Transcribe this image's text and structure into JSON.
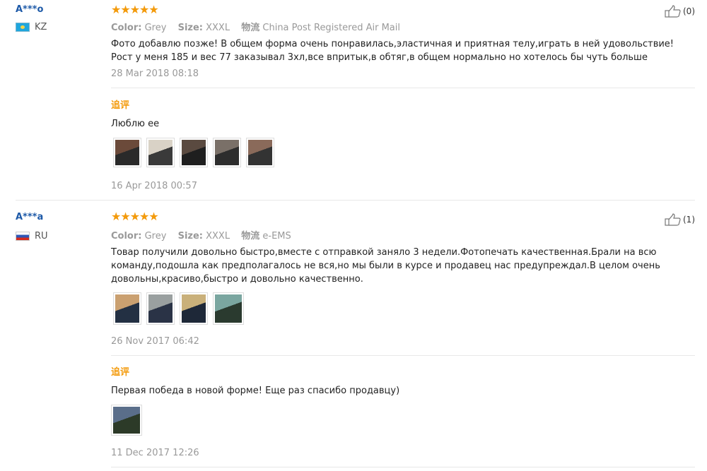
{
  "reviews": [
    {
      "user": "A***o",
      "country": "KZ",
      "flag_icon": "flag-kz-icon",
      "stars": "★★★★★",
      "rating": 5,
      "color_label": "Color:",
      "color_value": "Grey",
      "size_label": "Size:",
      "size_value": "XXXL",
      "ship_label": "物流",
      "ship_value": "China Post Registered Air Mail",
      "text": "Фото добавлю позже! В общем форма очень понравилась,эластичная и приятная телу,играть в ней удовольствие! Рост у меня 185 и вес 77 заказывал 3хл,все впритык,в обтяг,в общем нормально но хотелось бы чуть больше",
      "date": "28 Mar 2018 08:18",
      "likes": "(0)",
      "followup": {
        "tag": "追评",
        "text": "Люблю ее",
        "date": "16 Apr 2018 00:57",
        "thumbs": [
          {
            "colors": [
              "#6b4a3a",
              "#2a2a2a"
            ]
          },
          {
            "colors": [
              "#d9d2c6",
              "#3a3a3a"
            ]
          },
          {
            "colors": [
              "#5a4a40",
              "#1f1f1f"
            ]
          },
          {
            "colors": [
              "#7a7068",
              "#2d2d2d"
            ]
          },
          {
            "colors": [
              "#8a6a5a",
              "#333333"
            ]
          }
        ]
      }
    },
    {
      "user": "A***a",
      "country": "RU",
      "flag_icon": "flag-ru-icon",
      "stars": "★★★★★",
      "rating": 5,
      "color_label": "Color:",
      "color_value": "Grey",
      "size_label": "Size:",
      "size_value": "XXXL",
      "ship_label": "物流",
      "ship_value": "e-EMS",
      "text": "Товар получили довольно быстро,вместе с отправкой заняло 3 недели.Фотопечать качественная.Брали на всю команду,подошла как предполагалось не вся,но мы были в курсе и продавец нас предупреждал.В целом очень довольны,красиво,быстро и довольно качественно.",
      "date": "26 Nov 2017 06:42",
      "likes": "(1)",
      "thumbs": [
        {
          "colors": [
            "#caa070",
            "#233043"
          ]
        },
        {
          "colors": [
            "#9aa0a0",
            "#2a3346"
          ]
        },
        {
          "colors": [
            "#c9b07a",
            "#1e2838"
          ]
        },
        {
          "colors": [
            "#7aa6a0",
            "#2a3a2f"
          ]
        }
      ],
      "followup": {
        "tag": "追评",
        "text": "Первая победа в новой форме! Еще раз спасибо продавцу)",
        "date": "11 Dec 2017 12:26",
        "thumbs": [
          {
            "colors": [
              "#5a6e8a",
              "#2c3a28"
            ]
          }
        ]
      }
    }
  ]
}
